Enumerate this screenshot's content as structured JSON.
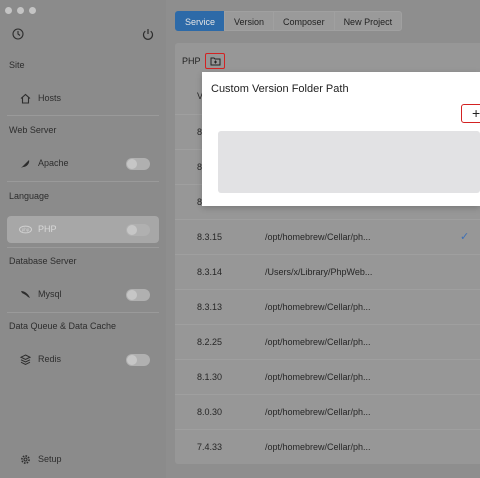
{
  "sidebar": {
    "sections": {
      "site": "Site",
      "web_server": "Web Server",
      "language": "Language",
      "database_server": "Database Server",
      "data_queue": "Data Queue & Data Cache"
    },
    "items": {
      "hosts": "Hosts",
      "apache": "Apache",
      "php": "PHP",
      "mysql": "Mysql",
      "redis": "Redis",
      "setup": "Setup"
    }
  },
  "tabs": [
    "Service",
    "Version",
    "Composer",
    "New Project"
  ],
  "panel": {
    "heading": "PHP"
  },
  "rows": [
    {
      "version": "8.3.15",
      "path": "/opt/homebrew/Cellar/ph...",
      "active": true
    },
    {
      "version": "8.3.14",
      "path": "/Users/x/Library/PhpWeb...",
      "active": false
    },
    {
      "version": "8.3.13",
      "path": "/opt/homebrew/Cellar/ph...",
      "active": false
    },
    {
      "version": "8.2.25",
      "path": "/opt/homebrew/Cellar/ph...",
      "active": false
    },
    {
      "version": "8.1.30",
      "path": "/opt/homebrew/Cellar/ph...",
      "active": false
    },
    {
      "version": "8.0.30",
      "path": "/opt/homebrew/Cellar/ph...",
      "active": false
    },
    {
      "version": "7.4.33",
      "path": "/opt/homebrew/Cellar/ph...",
      "active": false
    }
  ],
  "partial_rows": [
    "V",
    "8",
    "8",
    "8"
  ],
  "dialog": {
    "title": "Custom Version Folder Path",
    "add_label": "+"
  },
  "check_mark": "✓",
  "colors": {
    "accent": "#2d6aa8",
    "highlight": "#d32222",
    "check": "#3e70b5"
  }
}
